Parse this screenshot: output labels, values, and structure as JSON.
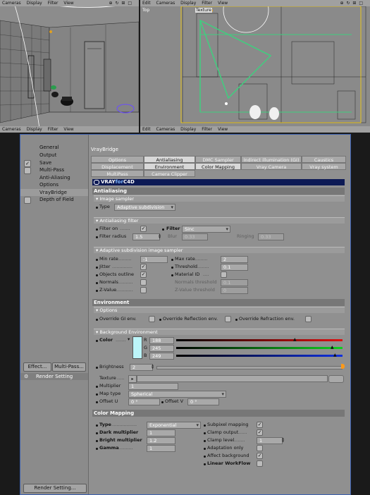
{
  "viewports": {
    "left_menu": [
      "Cameras",
      "Display",
      "Filter",
      "View"
    ],
    "right_menu": [
      "Edit",
      "Cameras",
      "Display",
      "Filter",
      "View"
    ],
    "right_labels": {
      "top": "Top",
      "texture": "Texture"
    },
    "bottom_left_menu": [
      "Cameras",
      "Display",
      "Filter",
      "View"
    ],
    "bottom_right_menu": [
      "Edit",
      "Cameras",
      "Display",
      "Filter",
      "View"
    ],
    "ctrl_glyphs": "⊕ ↻ ⊞ □"
  },
  "sidebar": {
    "items": [
      {
        "label": "General",
        "checked": ""
      },
      {
        "label": "Output",
        "checked": ""
      },
      {
        "label": "Save",
        "checked": "✓"
      },
      {
        "label": "Multi-Pass",
        "checked": ""
      },
      {
        "label": "Anti-Aliasing",
        "checked": ""
      },
      {
        "label": "Options",
        "checked": ""
      },
      {
        "label": "VrayBridge",
        "checked": ""
      },
      {
        "label": "Depth of Field",
        "checked": ""
      }
    ],
    "effect_button": "Effect...",
    "multipass_button": "Multi-Pass...",
    "render_setting_item": "Render Setting",
    "render_setting_button": "Render Setting..."
  },
  "main": {
    "title": "VrayBridge",
    "tabs_row1": [
      "Options",
      "Antialiasing",
      "DMC Sampler",
      "Indirect illumination (GI)",
      "Caustics"
    ],
    "tabs_row2": [
      "Displacement",
      "Environment",
      "Color Mapping",
      "Vray Camera",
      "Vray system"
    ],
    "tabs_row3": [
      "MultiPass",
      "Camera Clipper"
    ],
    "banner": {
      "vray": "VRAY",
      "for": "for",
      "c4d": "C4D"
    },
    "antialiasing": {
      "header": "Antialiasing",
      "image_sampler": "Image sampler",
      "type_label": "Type",
      "type_value": "Adaptive subdivision",
      "filter_header": "Antialiasing filter",
      "filter_on_label": "Filter on",
      "filter_on": "✓",
      "filter_label": "Filter",
      "filter_value": "Sinc",
      "filter_radius_label": "Filter radius",
      "filter_radius_value": "1.5",
      "blur_label": "Blur",
      "blur_value": "0.33",
      "ringing_label": "Ringing",
      "ringing_value": "0.33",
      "adaptive_header": "Adaptive subdivision image sampler",
      "min_rate_label": "Min rate",
      "min_rate_value": "-1",
      "max_rate_label": "Max rate",
      "max_rate_value": "2",
      "jitter_label": "Jitter",
      "jitter": "✓",
      "threshold_label": "Threshold",
      "threshold_value": "0.1",
      "objects_outline_label": "Objects outline",
      "objects_outline": "✓",
      "material_id_label": "Material ID",
      "normals_label": "Normals",
      "normals_threshold_label": "Normals threshold",
      "normals_threshold_value": "0.1",
      "zvalue_label": "Z-Value",
      "zvalue_threshold_label": "Z-Value threshold",
      "zvalue_threshold_value": "0"
    },
    "environment": {
      "header": "Environment",
      "options_header": "Options",
      "override_gi": "Override GI env.",
      "override_reflection": "Override Reflection env.",
      "override_refraction": "Override Refraction env.",
      "bg_header": "Background Environment",
      "color_label": "Color",
      "r_label": "R",
      "r_value": "188",
      "g_label": "G",
      "g_value": "245",
      "b_label": "B",
      "b_value": "249",
      "swatch_color": "#bcf5f9",
      "brightness_label": "Brightness",
      "brightness_value": "2",
      "texture_label": "Texture",
      "multiplier_label": "Multiplier",
      "multiplier_value": "1",
      "map_type_label": "Map type",
      "map_type_value": "Spherical",
      "offset_u_label": "Offset U",
      "offset_u_value": "0 °",
      "offset_v_label": "Offset V",
      "offset_v_value": "0 °"
    },
    "color_mapping": {
      "header": "Color Mapping",
      "type_label": "Type",
      "type_value": "Exponential",
      "dark_label": "Dark multiplier",
      "dark_value": "1",
      "bright_label": "Bright multiplier",
      "bright_value": "1.2",
      "gamma_label": "Gamma",
      "gamma_value": "1",
      "subpixel_label": "Subpixel mapping",
      "subpixel": "✓",
      "clamp_output_label": "Clamp output",
      "clamp_output": "✓",
      "clamp_level_label": "Clamp level",
      "clamp_level_value": "1",
      "adaptation_label": "Adaptation only",
      "affect_bg_label": "Affect background",
      "affect_bg": "✓",
      "linear_label": "Linear WorkFlow"
    }
  }
}
